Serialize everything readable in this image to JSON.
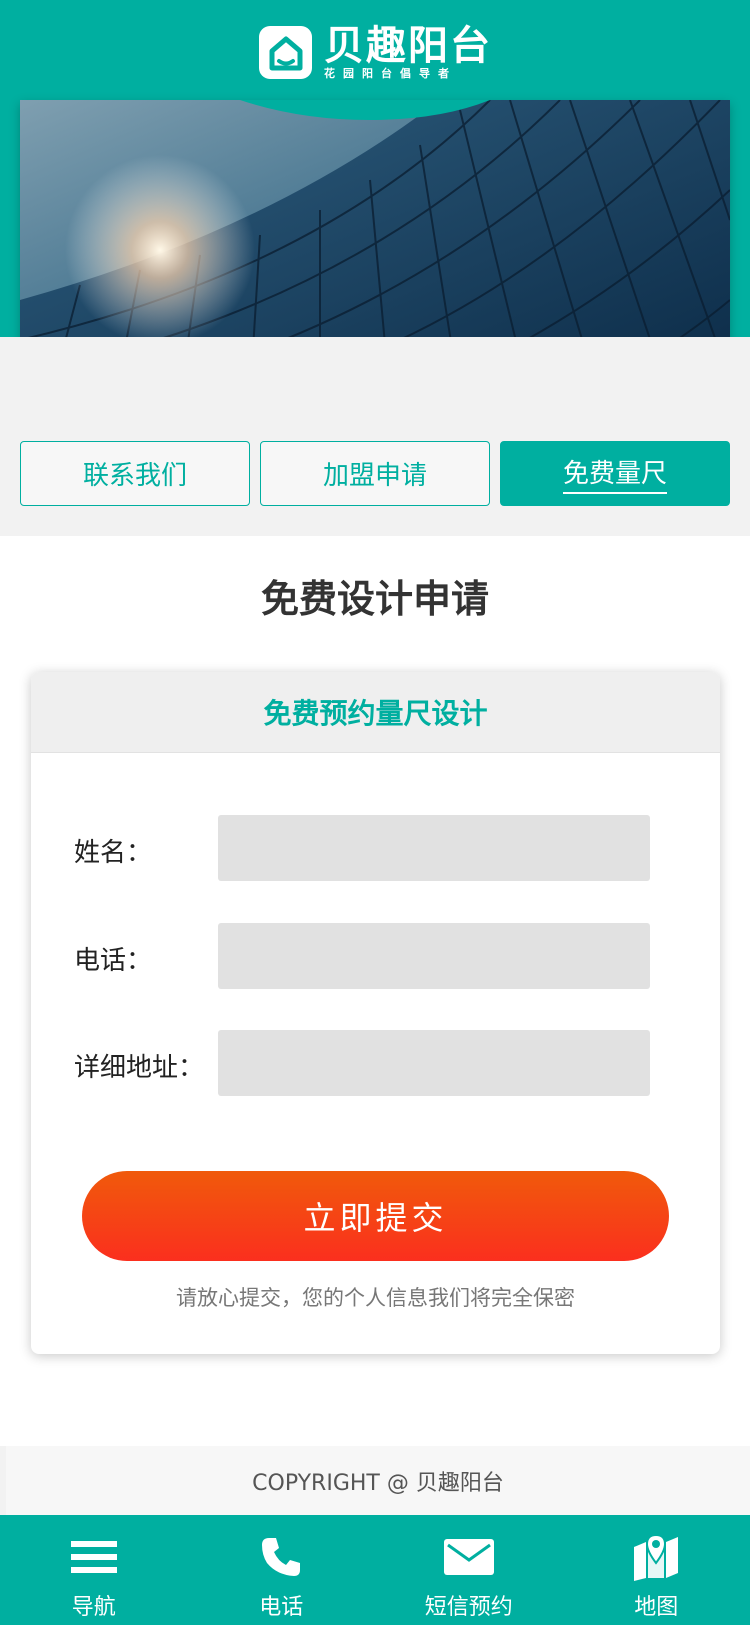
{
  "brand": {
    "name": "贝趣阳台",
    "slogan": "花园阳台倡导者",
    "accent_color": "#00afa0",
    "logo_icon": "house-icon"
  },
  "tabs": [
    {
      "label": "联系我们",
      "active": false
    },
    {
      "label": "加盟申请",
      "active": false
    },
    {
      "label": "免费量尺",
      "active": true
    }
  ],
  "page": {
    "title": "免费设计申请"
  },
  "form": {
    "heading": "免费预约量尺设计",
    "fields": [
      {
        "label": "姓名：",
        "value": "",
        "placeholder": ""
      },
      {
        "label": "电话：",
        "value": "",
        "placeholder": ""
      },
      {
        "label": "详细地址：",
        "value": "",
        "placeholder": ""
      }
    ],
    "submit_label": "立即提交",
    "submit_color": "#f73a1a",
    "privacy_note": "请放心提交，您的个人信息我们将完全保密"
  },
  "footer": {
    "copyright": "COPYRIGHT @ 贝趣阳台"
  },
  "bottom_nav": [
    {
      "label": "导航",
      "icon": "menu-icon"
    },
    {
      "label": "电话",
      "icon": "phone-icon"
    },
    {
      "label": "短信预约",
      "icon": "mail-icon"
    },
    {
      "label": "地图",
      "icon": "map-icon"
    }
  ]
}
